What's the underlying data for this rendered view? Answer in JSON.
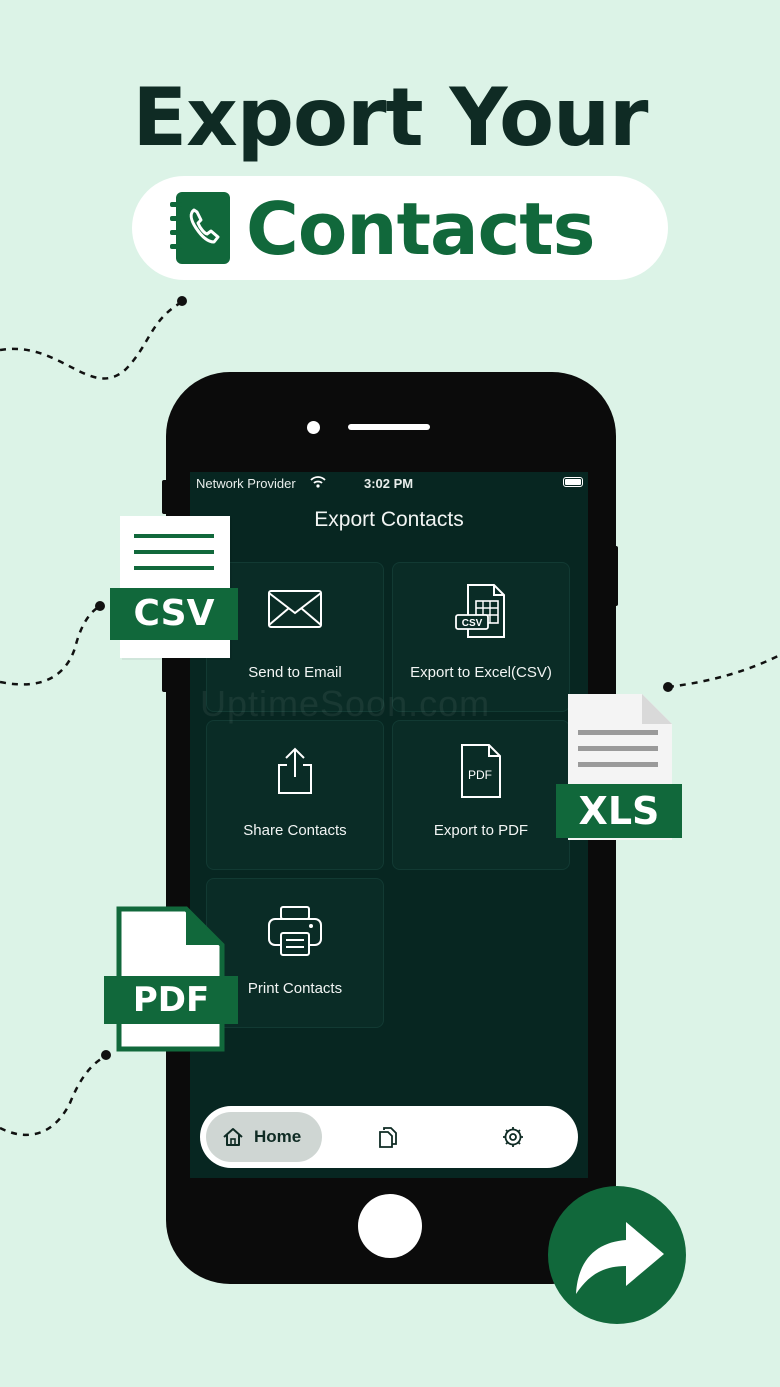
{
  "headline": {
    "line1": "Export Your",
    "line2": "Contacts"
  },
  "status_bar": {
    "carrier": "Network Provider",
    "time": "3:02 PM"
  },
  "screen": {
    "title": "Export Contacts",
    "options": [
      {
        "label": "Send to Email",
        "icon": "envelope-icon"
      },
      {
        "label": "Export to Excel(CSV)",
        "icon": "csv-spreadsheet-icon"
      },
      {
        "label": "Share Contacts",
        "icon": "share-icon"
      },
      {
        "label": "Export to PDF",
        "icon": "pdf-file-icon",
        "icon_text": "PDF"
      },
      {
        "label": "Print Contacts",
        "icon": "printer-icon"
      }
    ],
    "csv_icon_text": "CSV"
  },
  "bottom_nav": {
    "home_label": "Home",
    "items": [
      "home-icon",
      "documents-icon",
      "settings-icon"
    ]
  },
  "floating_badges": {
    "csv": "CSV",
    "xls": "XLS",
    "pdf": "PDF"
  },
  "watermark": "UptimeSoon.com",
  "colors": {
    "background": "#dcf3e7",
    "brand_green": "#11683b",
    "headline_dark": "#0f2b24",
    "screen_bg": "#072621",
    "card_bg": "#0a2c26"
  }
}
